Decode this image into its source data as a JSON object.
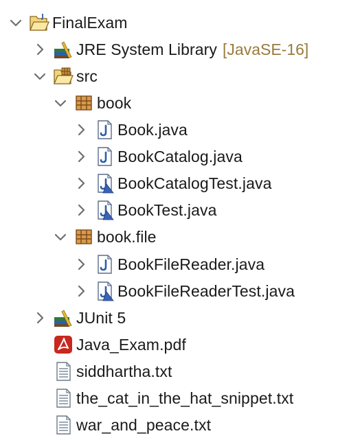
{
  "tree": {
    "project": {
      "label": "FinalExam"
    },
    "jre": {
      "label": "JRE System Library",
      "decoration": "[JavaSE-16]"
    },
    "src": {
      "label": "src"
    },
    "pkg_book": {
      "label": "book"
    },
    "book_java": {
      "label": "Book.java"
    },
    "bookcatalog_java": {
      "label": "BookCatalog.java"
    },
    "bookcatalogtest_java": {
      "label": "BookCatalogTest.java"
    },
    "booktest_java": {
      "label": "BookTest.java"
    },
    "pkg_book_file": {
      "label": "book.file"
    },
    "bookfilereader_java": {
      "label": "BookFileReader.java"
    },
    "bookfilereadertest_java": {
      "label": "BookFileReaderTest.java"
    },
    "junit": {
      "label": "JUnit 5"
    },
    "java_exam_pdf": {
      "label": "Java_Exam.pdf"
    },
    "siddhartha_txt": {
      "label": "siddhartha.txt"
    },
    "cat_txt": {
      "label": "the_cat_in_the_hat_snippet.txt"
    },
    "war_txt": {
      "label": "war_and_peace.txt"
    }
  },
  "colors": {
    "decoration": "#9a7a3c",
    "chevron": "#6e6e6e",
    "java_blue": "#2b5fa8",
    "pdf_red": "#c8281e"
  }
}
